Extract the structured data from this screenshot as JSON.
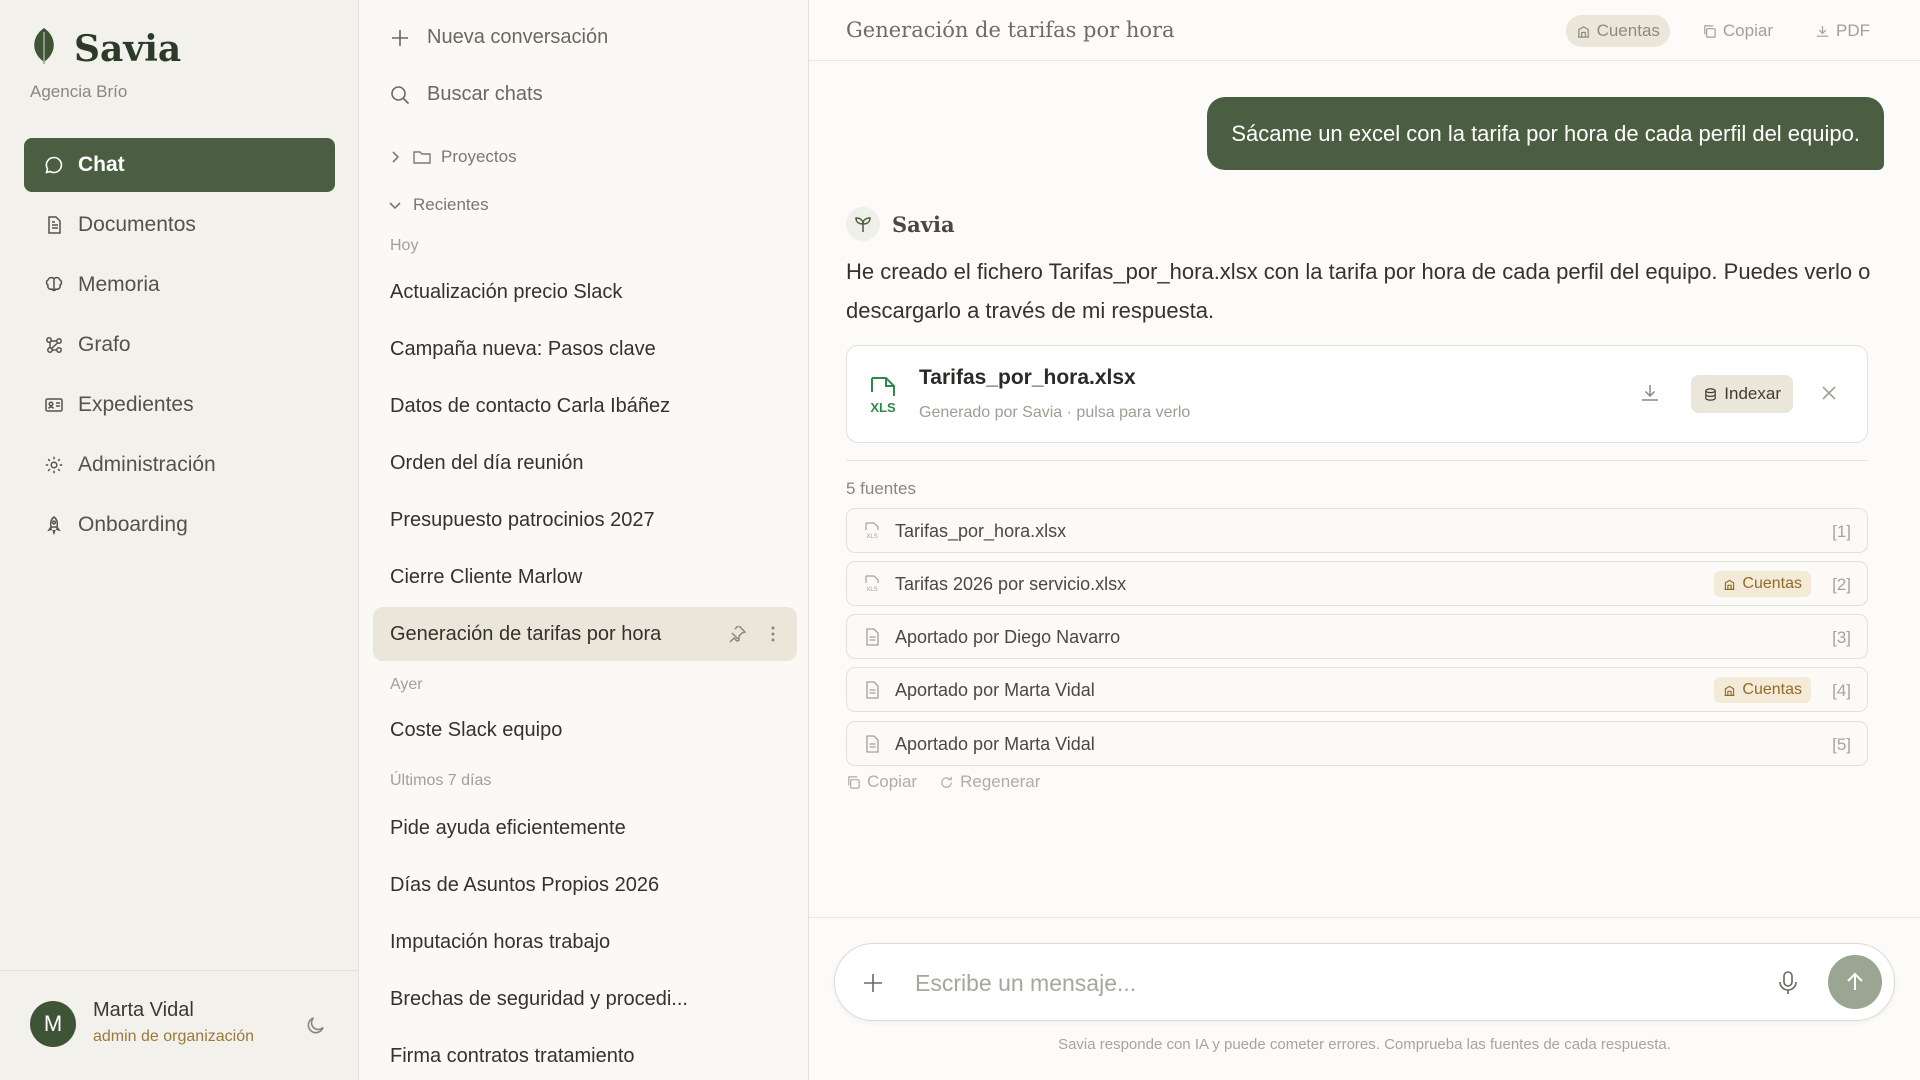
{
  "app": {
    "name": "Savia",
    "org": "Agencia Brío"
  },
  "nav": {
    "items": [
      {
        "label": "Chat",
        "icon": "chat-icon"
      },
      {
        "label": "Documentos",
        "icon": "document-icon"
      },
      {
        "label": "Memoria",
        "icon": "brain-icon"
      },
      {
        "label": "Grafo",
        "icon": "graph-icon"
      },
      {
        "label": "Expedientes",
        "icon": "id-card-icon"
      },
      {
        "label": "Administración",
        "icon": "gear-icon"
      },
      {
        "label": "Onboarding",
        "icon": "rocket-icon"
      }
    ],
    "active": "Chat"
  },
  "user": {
    "initial": "M",
    "name": "Marta Vidal",
    "role": "admin de organización"
  },
  "chats": {
    "new_label": "Nueva conversación",
    "search_label": "Buscar chats",
    "projects_label": "Proyectos",
    "recent_label": "Recientes",
    "today_label": "Hoy",
    "yesterday_label": "Ayer",
    "last7_label": "Últimos 7 días",
    "today": [
      "Actualización precio Slack",
      "Campaña nueva: Pasos clave",
      "Datos de contacto Carla Ibáñez",
      "Orden del día reunión",
      "Presupuesto patrocinios 2027",
      "Cierre Cliente Marlow",
      "Generación de tarifas por hora"
    ],
    "yesterday": [
      "Coste Slack equipo"
    ],
    "last7": [
      "Pide ayuda eficientemente",
      "Días de Asuntos Propios 2026",
      "Imputación horas trabajo",
      "Brechas de seguridad y procedi...",
      "Firma contratos tratamiento"
    ]
  },
  "conversation": {
    "title": "Generación de tarifas por hora",
    "top_actions": {
      "space": "Cuentas",
      "copy": "Copiar",
      "pdf": "PDF"
    },
    "user_message": "Sácame un excel con la tarifa por hora de cada perfil del equipo.",
    "assistant_name": "Savia",
    "assistant_message": "He creado el fichero Tarifas_por_hora.xlsx con la tarifa por hora de cada perfil del equipo. Puedes verlo o descargarlo a través de mi respuesta.",
    "file": {
      "type_label": "XLS",
      "name": "Tarifas_por_hora.xlsx",
      "subtitle": "Generado por Savia · pulsa para verlo",
      "index_label": "Indexar"
    },
    "sources_label": "5 fuentes",
    "sources": [
      {
        "name": "Tarifas_por_hora.xlsx",
        "icon": "spreadsheet-icon",
        "tag": "",
        "ref": "[1]"
      },
      {
        "name": "Tarifas 2026 por servicio.xlsx",
        "icon": "spreadsheet-icon",
        "tag": "Cuentas",
        "ref": "[2]"
      },
      {
        "name": "Aportado por Diego Navarro",
        "icon": "document-icon",
        "tag": "",
        "ref": "[3]"
      },
      {
        "name": "Aportado por Marta Vidal",
        "icon": "document-icon",
        "tag": "Cuentas",
        "ref": "[4]"
      },
      {
        "name": "Aportado por Marta Vidal",
        "icon": "document-icon",
        "tag": "",
        "ref": "[5]"
      }
    ],
    "msg_actions": {
      "copy": "Copiar",
      "regen": "Regenerar"
    }
  },
  "composer": {
    "placeholder": "Escribe un mensaje...",
    "disclaimer": "Savia responde con IA y puede cometer errores. Comprueba las fuentes de cada respuesta."
  },
  "colors": {
    "brand": "#4b5e41",
    "accent_tag": "#946a25"
  }
}
